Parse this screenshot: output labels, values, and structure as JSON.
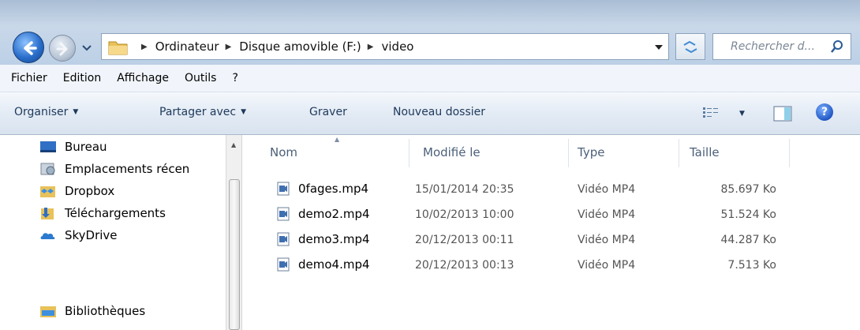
{
  "address": {
    "crumbs": [
      "Ordinateur",
      "Disque amovible (F:)",
      "video"
    ],
    "search_placeholder": "Rechercher d..."
  },
  "menu": [
    "Fichier",
    "Edition",
    "Affichage",
    "Outils",
    "?"
  ],
  "commands": {
    "organize": "Organiser",
    "share": "Partager avec",
    "burn": "Graver",
    "new_folder": "Nouveau dossier",
    "help": "?"
  },
  "nav": [
    {
      "label": "Bureau",
      "icon": "desktop-icon"
    },
    {
      "label": "Emplacements récen",
      "icon": "recent-places-icon"
    },
    {
      "label": "Dropbox",
      "icon": "dropbox-icon"
    },
    {
      "label": "Téléchargements",
      "icon": "downloads-icon"
    },
    {
      "label": "SkyDrive",
      "icon": "skydrive-icon"
    },
    {
      "label": "Bibliothèques",
      "icon": "libraries-icon"
    }
  ],
  "columns": {
    "name": "Nom",
    "modified": "Modifié le",
    "type": "Type",
    "size": "Taille"
  },
  "files": [
    {
      "name": "0fages.mp4",
      "modified": "15/01/2014 20:35",
      "type": "Vidéo MP4",
      "size": "85.697 Ko"
    },
    {
      "name": "demo2.mp4",
      "modified": "10/02/2013 10:00",
      "type": "Vidéo MP4",
      "size": "51.524 Ko"
    },
    {
      "name": "demo3.mp4",
      "modified": "20/12/2013 00:11",
      "type": "Vidéo MP4",
      "size": "44.287 Ko"
    },
    {
      "name": "demo4.mp4",
      "modified": "20/12/2013 00:13",
      "type": "Vidéo MP4",
      "size": "7.513 Ko"
    }
  ],
  "colors": {
    "accent": "#1e395b",
    "header_text": "#4c607a"
  }
}
